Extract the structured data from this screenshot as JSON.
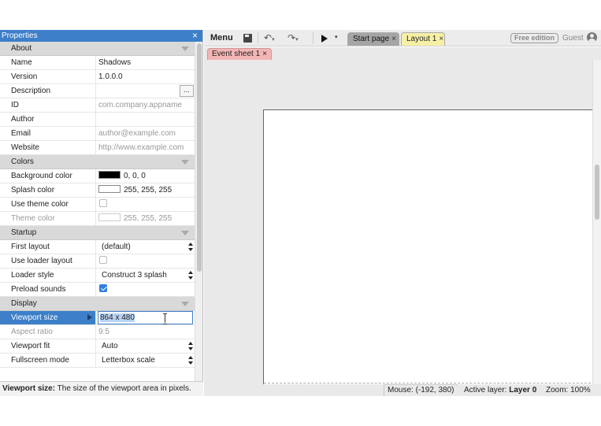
{
  "properties_panel": {
    "title": "Properties",
    "sections": [
      {
        "title": "About",
        "rows": [
          {
            "name": "Name",
            "value": "Shadows"
          },
          {
            "name": "Version",
            "value": "1.0.0.0"
          },
          {
            "name": "Description",
            "value": ""
          },
          {
            "name": "ID",
            "value": "com.company.appname"
          },
          {
            "name": "Author",
            "value": ""
          },
          {
            "name": "Email",
            "value": "author@example.com"
          },
          {
            "name": "Website",
            "value": "http://www.example.com"
          }
        ]
      },
      {
        "title": "Colors",
        "rows": [
          {
            "name": "Background color",
            "value": "0, 0, 0",
            "swatch": "#000000"
          },
          {
            "name": "Splash color",
            "value": "255, 255, 255",
            "swatch": "#ffffff"
          },
          {
            "name": "Use theme color",
            "checked": false
          },
          {
            "name": "Theme color",
            "value": "255, 255, 255",
            "swatch": "#ffffff"
          }
        ]
      },
      {
        "title": "Startup",
        "rows": [
          {
            "name": "First layout",
            "value": "(default)"
          },
          {
            "name": "Use loader layout",
            "checked": false
          },
          {
            "name": "Loader style",
            "value": "Construct 3 splash"
          },
          {
            "name": "Preload sounds",
            "checked": true
          }
        ]
      },
      {
        "title": "Display",
        "rows": [
          {
            "name": "Viewport size",
            "value": "864 x 480"
          },
          {
            "name": "Aspect ratio",
            "value": "9:5"
          },
          {
            "name": "Viewport fit",
            "value": "Auto"
          },
          {
            "name": "Fullscreen mode",
            "value": "Letterbox scale"
          }
        ]
      }
    ],
    "description_button": "...",
    "footer": {
      "label": "Viewport size:",
      "text": "The size of the viewport area in pixels."
    }
  },
  "toolbar": {
    "menu_label": "Menu",
    "undo_glyph": "↶",
    "redo_glyph": "↷",
    "caret": "▾",
    "tabs": [
      {
        "label": "Start page",
        "close": "×"
      },
      {
        "label": "Layout 1",
        "close": "×"
      }
    ],
    "edition_badge": "Free edition",
    "user_label": "Guest"
  },
  "tabrow2": {
    "tab": {
      "label": "Event sheet 1",
      "close": "×"
    }
  },
  "statusbar": {
    "mouse": "Mouse: (-192, 380)",
    "active_layer_label": "Active layer:",
    "active_layer_value": "Layer 0",
    "zoom": "Zoom: 100%"
  },
  "icons": {
    "close": "×"
  },
  "colors": {
    "panel_title_bg": "#3d7fc9",
    "selected_row_bg": "#3d7fc9",
    "layout_tab_bg": "#f6f0a6",
    "event_tab_bg": "#f2b5b5",
    "start_tab_bg": "#a5a5a5"
  }
}
